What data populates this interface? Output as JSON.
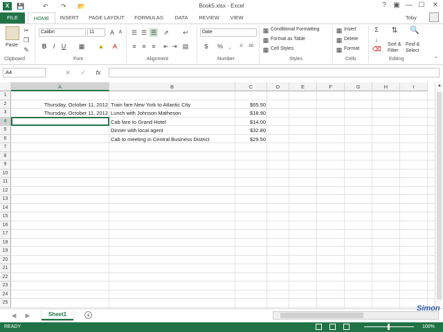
{
  "window": {
    "title": "Book5.xlsx - Excel",
    "user": "Toby"
  },
  "tabs": [
    "FILE",
    "HOME",
    "INSERT",
    "PAGE LAYOUT",
    "FORMULAS",
    "DATA",
    "REVIEW",
    "VIEW"
  ],
  "ribbon": {
    "clipboard": {
      "paste": "Paste",
      "label": "Clipboard"
    },
    "font": {
      "name": "Calibri",
      "size": "11",
      "bold": "B",
      "italic": "I",
      "underline": "U",
      "label": "Font"
    },
    "alignment": {
      "label": "Alignment"
    },
    "number": {
      "format": "Date",
      "currency": "$",
      "percent": "%",
      "comma": ",",
      "label": "Number"
    },
    "styles": {
      "conditional": "Conditional Formatting",
      "table": "Format as Table",
      "cell": "Cell Styles",
      "label": "Styles"
    },
    "cells": {
      "insert": "Insert",
      "delete": "Delete",
      "format": "Format",
      "label": "Cells"
    },
    "editing": {
      "sort": "Sort &",
      "sort2": "Filter",
      "find": "Find &",
      "find2": "Select",
      "label": "Editing"
    }
  },
  "formula_bar": {
    "name_box": "A4",
    "fx": "fx",
    "value": ""
  },
  "columns": [
    "A",
    "B",
    "C",
    "D",
    "E",
    "F",
    "G",
    "H",
    "I"
  ],
  "rows": [
    "1",
    "2",
    "3",
    "4",
    "5",
    "6",
    "7",
    "8",
    "9",
    "10",
    "11",
    "12",
    "13",
    "14",
    "15",
    "16",
    "17",
    "18",
    "19",
    "20",
    "21",
    "22",
    "23",
    "24",
    "25"
  ],
  "cells": {
    "A2": "Thursday, October 11, 2012",
    "B2": "Train fare New York to Atlantic City",
    "C2": "$65.50",
    "A3": "Thursday, October 11, 2012",
    "B3": "Lunch with Johnson Matheson",
    "C3": "$18.90",
    "B4": "Cab fare to Grand Hotel",
    "C4": "$14.00",
    "B5": "Dinner with local agent",
    "C5": "$32.80",
    "B6": "Cab to meeting in Central Business District",
    "C6": "$29.50"
  },
  "sheet_tab": "Sheet1",
  "status": {
    "mode": "READY",
    "zoom": "100%"
  },
  "watermark": "Simon",
  "colors": {
    "excel_green": "#217346"
  }
}
